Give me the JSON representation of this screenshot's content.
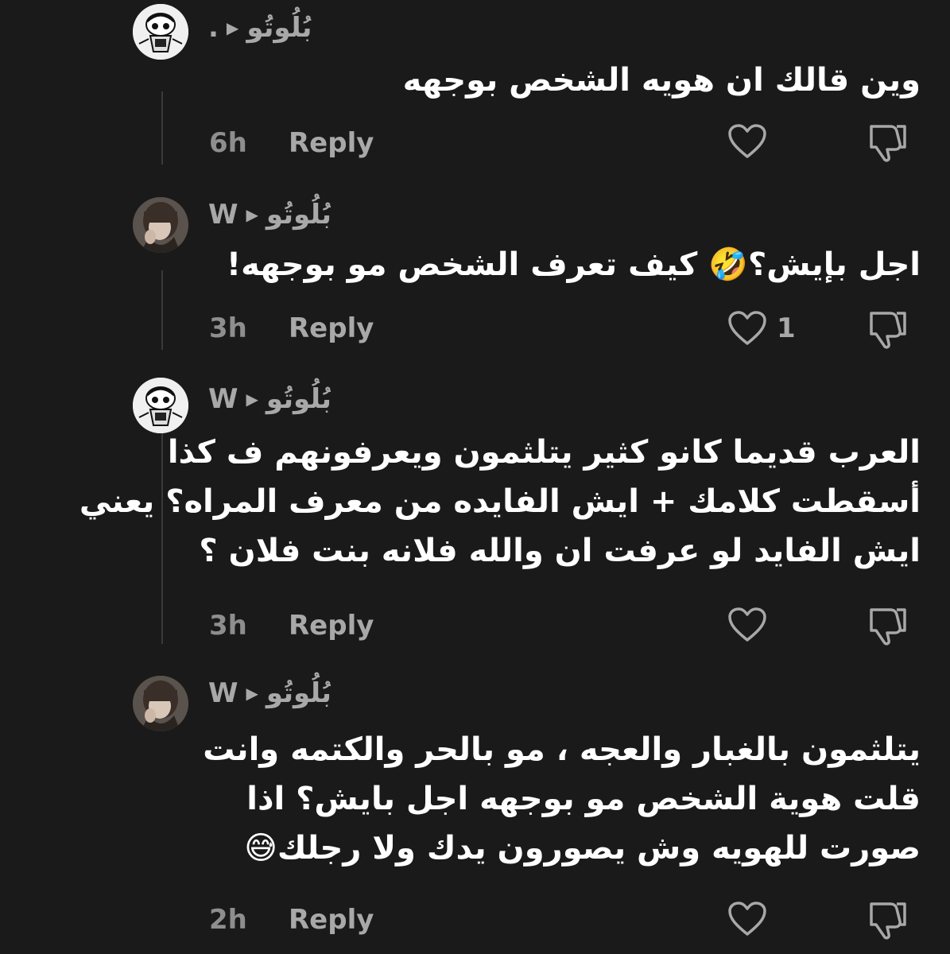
{
  "comments": [
    {
      "author": "بُلُوتُو",
      "reply_to": ".",
      "avatar": "manga-skull-avatar",
      "lines": [
        "وين قالك ان هويه الشخص بوجهه"
      ],
      "time": "6h",
      "reply_label": "Reply",
      "likes": ""
    },
    {
      "author": "بُلُوتُو",
      "reply_to": "W",
      "avatar": "girl-photo-avatar",
      "lines": [
        "اجل بإيش؟🤣 كيف تعرف الشخص مو بوجهه!"
      ],
      "time": "3h",
      "reply_label": "Reply",
      "likes": "1"
    },
    {
      "author": "بُلُوتُو",
      "reply_to": "W",
      "avatar": "manga-skull-avatar",
      "lines": [
        "العرب قديما كانو كثير يتلثمون ويعرفونهم ف كذا",
        "أسقطت كلامك + ايش الفايده من معرف المراه؟ يعني",
        "ايش الفايد لو عرفت ان والله فلانه بنت فلان ؟"
      ],
      "time": "3h",
      "reply_label": "Reply",
      "likes": ""
    },
    {
      "author": "بُلُوتُو",
      "reply_to": "W",
      "avatar": "girl-photo-avatar",
      "lines": [
        "يتلثمون بالغبار والعجه ، مو بالحر والكتمه وانت",
        "قلت هوية الشخص مو بوجهه اجل بايش؟ اذا",
        "صورت للهويه وش يصورون يدك ولا رجلك😅"
      ],
      "time": "2h",
      "reply_label": "Reply",
      "likes": ""
    }
  ]
}
